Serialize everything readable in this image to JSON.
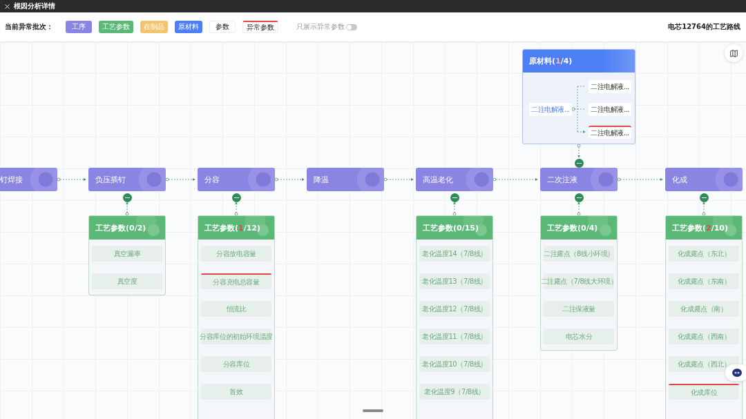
{
  "window": {
    "title": "根因分析详情"
  },
  "toolbar": {
    "label": "当前异常批次：",
    "legend": [
      {
        "label": "工序",
        "kind": "fill",
        "color": "#8a84e2"
      },
      {
        "label": "工艺参数",
        "kind": "fill",
        "color": "#5cb876"
      },
      {
        "label": "在制品",
        "kind": "fill",
        "color": "#f5c46e"
      },
      {
        "label": "原材料",
        "kind": "fill",
        "color": "#4c7ff6"
      },
      {
        "label": "参数",
        "kind": "plain",
        "color": "#ffffff"
      },
      {
        "label": "异常参数",
        "kind": "abnormal",
        "color": "#ffffff"
      }
    ],
    "toggle": {
      "label": "只展示异常参数",
      "on": false
    },
    "route_title": "电芯12764的工艺路线"
  },
  "process_nodes": [
    {
      "label": "钉焊接"
    },
    {
      "label": "负压插钉",
      "params": {
        "header_parts": [
          {
            "text": "工艺参数(0/2)",
            "abnormal": false
          }
        ],
        "items": [
          {
            "label": "真空漏率",
            "abnormal": false
          },
          {
            "label": "真空度",
            "abnormal": false
          }
        ]
      }
    },
    {
      "label": "分容",
      "params": {
        "header_parts": [
          {
            "text": "工艺参数(",
            "abnormal": false
          },
          {
            "text": "1",
            "abnormal": true
          },
          {
            "text": "/12)",
            "abnormal": false
          }
        ],
        "items": [
          {
            "label": "分容放电容量",
            "abnormal": false
          },
          {
            "label": "分容充电总容量",
            "abnormal": true
          },
          {
            "label": "恒流比",
            "abnormal": false
          },
          {
            "label": "分容库位的初始环境温度",
            "abnormal": false
          },
          {
            "label": "分容库位",
            "abnormal": false
          },
          {
            "label": "首效",
            "abnormal": false
          }
        ]
      }
    },
    {
      "label": "降温"
    },
    {
      "label": "高温老化",
      "params": {
        "header_parts": [
          {
            "text": "工艺参数(0/15)",
            "abnormal": false
          }
        ],
        "items": [
          {
            "label": "老化温度14（7/8线）",
            "abnormal": false
          },
          {
            "label": "老化温度13（7/8线）",
            "abnormal": false
          },
          {
            "label": "老化温度12（7/8线）",
            "abnormal": false
          },
          {
            "label": "老化温度11（7/8线）",
            "abnormal": false
          },
          {
            "label": "老化温度10（7/8线）",
            "abnormal": false
          },
          {
            "label": "老化温度9（7/8线）",
            "abnormal": false
          }
        ]
      }
    },
    {
      "label": "二次注液",
      "materials": {
        "header_parts": [
          {
            "text": "原材料(",
            "abnormal": false
          },
          {
            "text": "1",
            "abnormal": true
          },
          {
            "text": "/4)",
            "abnormal": false
          }
        ],
        "source": {
          "label": "二注电解液..."
        },
        "targets": [
          {
            "label": "二注电解液...",
            "abnormal": false
          },
          {
            "label": "二注电解液...",
            "abnormal": false
          },
          {
            "label": "二注电解液...",
            "abnormal": true
          }
        ]
      },
      "params": {
        "header_parts": [
          {
            "text": "工艺参数(0/4)",
            "abnormal": false
          }
        ],
        "items": [
          {
            "label": "二注露点（8线小环境）",
            "abnormal": false
          },
          {
            "label": "二注露点（7/8线大环境）",
            "abnormal": false
          },
          {
            "label": "二注保液量",
            "abnormal": false
          },
          {
            "label": "电芯水分",
            "abnormal": false
          }
        ]
      }
    },
    {
      "label": "化成",
      "params": {
        "header_parts": [
          {
            "text": "工艺参数(",
            "abnormal": false
          },
          {
            "text": "2",
            "abnormal": true
          },
          {
            "text": "/10)",
            "abnormal": false
          }
        ],
        "items": [
          {
            "label": "化成露点（东北）",
            "abnormal": false
          },
          {
            "label": "化成露点（东南）",
            "abnormal": false
          },
          {
            "label": "化成露点（南）",
            "abnormal": false
          },
          {
            "label": "化成露点（西南）",
            "abnormal": false
          },
          {
            "label": "化成露点（西北）",
            "abnormal": false
          },
          {
            "label": "化成库位",
            "abnormal": true
          }
        ]
      }
    }
  ]
}
